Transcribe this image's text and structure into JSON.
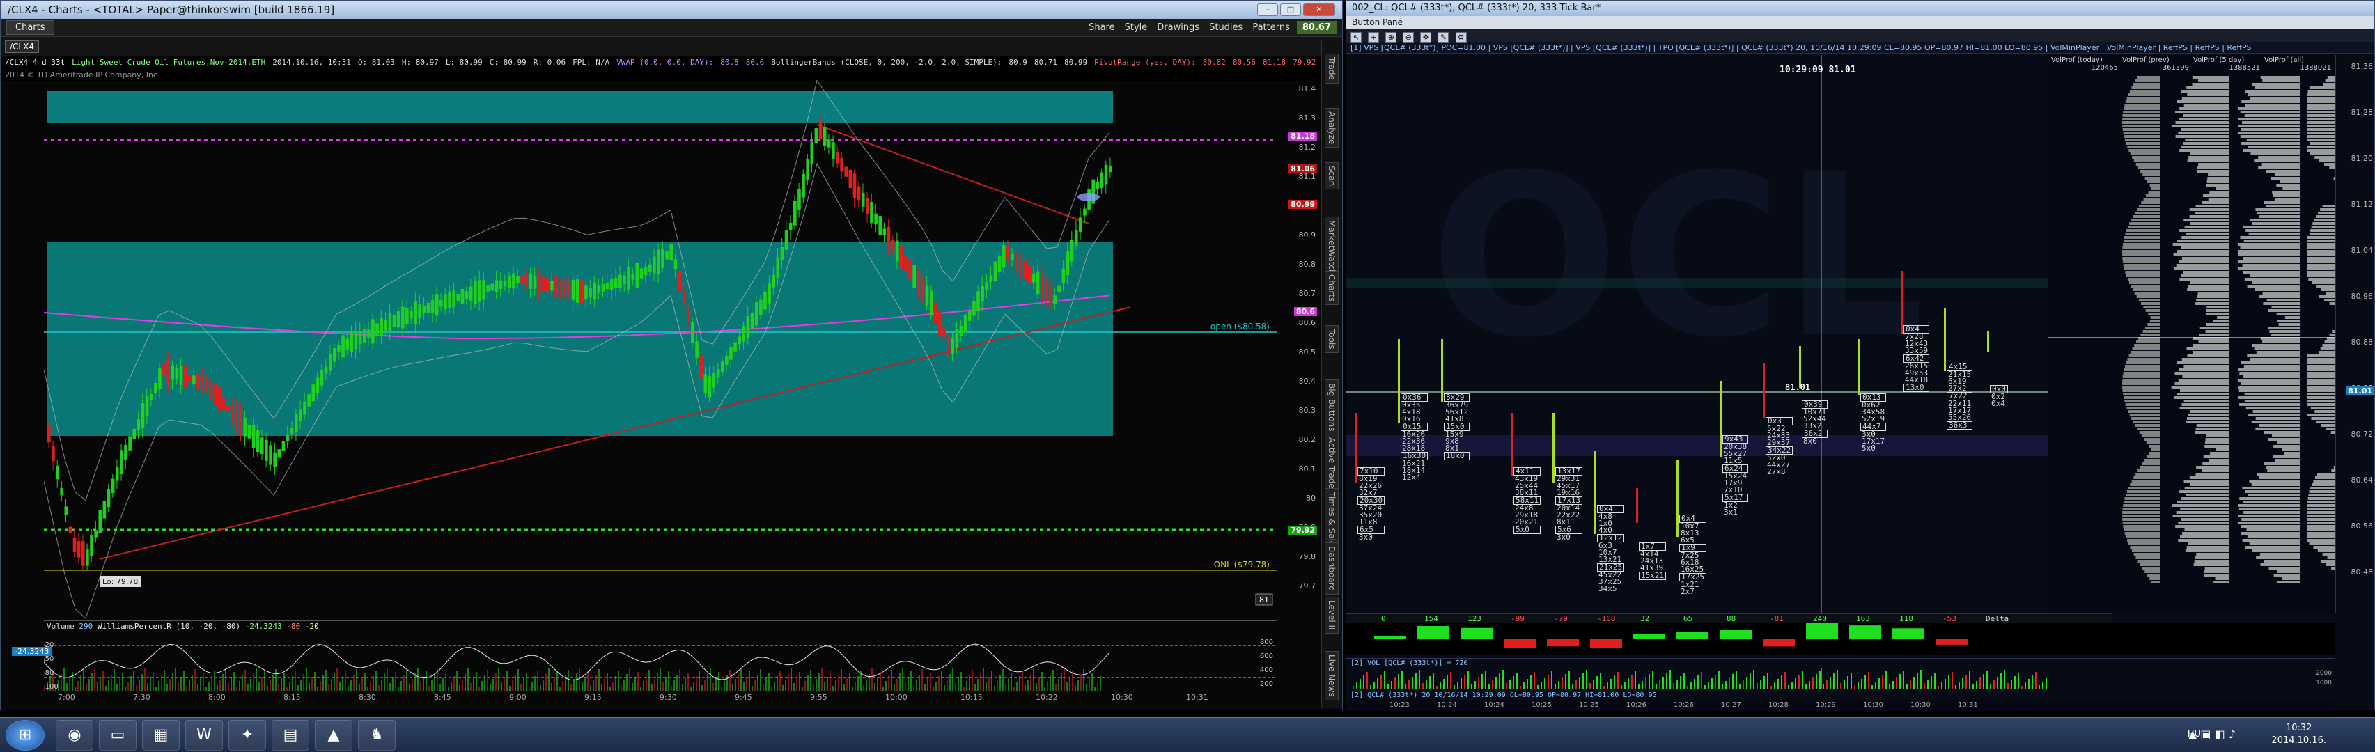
{
  "left_window": {
    "title": "/CLX4 - Charts - <TOTAL> Paper@thinkorswim [build 1866.19]",
    "tab": "Charts",
    "toolbar": {
      "symbol": "/CLX4",
      "share": "Share",
      "style": "Style",
      "drawings": "Drawings",
      "studies": "Studies",
      "patterns": "Patterns",
      "last_price": "80.67"
    },
    "study_row1": [
      "/CLX4 4 d 33t",
      "Light Sweet Crude Oil Futures,Nov-2014,ETH",
      "2014.10.16, 10:31",
      "O: 81.03",
      "H: 80.97",
      "L: 80.99",
      "C: 80.99",
      "R: 0.06",
      "FPL: N/A",
      "VWAP (0.0, 0.0, DAY):",
      "80.8",
      "80.6",
      "BollingerBands (CLOSE, 0, 200, -2.0, 2.0, SIMPLE):",
      "80.9",
      "80.71",
      "80.99",
      "PivotRange (yes, DAY):",
      "80.82",
      "80.56",
      "81.18",
      "79.92",
      "78.74"
    ],
    "study_row2": "2014 © TD Ameritrade IP Company, Inc.",
    "price_ticks": [
      "81.4",
      "81.3",
      "81.2",
      "81.1",
      "81",
      "80.9",
      "80.8",
      "80.7",
      "80.6",
      "80.5",
      "80.4",
      "80.3",
      "80.2",
      "80.1",
      "80",
      "79.9",
      "79.8",
      "79.7"
    ],
    "price_flags": [
      {
        "label": "81.18",
        "color": "#c83ad8"
      },
      {
        "label": "81.06",
        "color": "#b01818"
      },
      {
        "label": "80.99",
        "color": "#c81818"
      },
      {
        "label": "80.6",
        "color": "#c83ad8"
      },
      {
        "label": "79.92",
        "color": "#19a019"
      }
    ],
    "annotations": {
      "open_label": "open ($80.58)",
      "onl_label": "ONL ($79.78)",
      "lo_label": "Lo: 79.78",
      "page_num": "81"
    },
    "lower_study": {
      "label1": "Volume",
      "val1": "290",
      "label2": "WilliamsPercentR (10, -20, -80)",
      "val2": "-24.3243",
      "val3": "-80",
      "val4": "-20",
      "current": "-24.3243",
      "ticks": [
        "-20",
        "-50",
        "-80",
        "-100"
      ],
      "right_ticks": [
        "800",
        "600",
        "400",
        "200"
      ]
    },
    "time_labels": [
      "7:00",
      "7:30",
      "8:00",
      "8:15",
      "8:30",
      "8:45",
      "9:00",
      "9:15",
      "9:30",
      "9:45",
      "9:55",
      "10:00",
      "10:15",
      "10:22",
      "10:30",
      "10:31"
    ],
    "side_tabs": [
      "Trade",
      "Analyze",
      "Scan",
      "MarketWatch",
      "Charts",
      "Tools",
      "Big Buttons",
      "Active Trader",
      "Times & Sales",
      "Dashboard",
      "Level II",
      "Live News"
    ]
  },
  "right_window": {
    "title": "002_CL: QCL# (333t*), QCL# (333t*) 20, 333 Tick Bar*",
    "subtitle": "Button Pane",
    "study_line": "[1] VPS [QCL# (333t*)] POC=81.00 | VPS [QCL# (333t*)] | VPS [QCL# (333t*)] | TPO [QCL# (333t*)] | QCL# (333t*) 20, 10/16/14 10:29:09 CL=80.95 OP=80.97 HI=81.00 LO=80.95 | VolMinPlayer | VolMinPlayer | ReffPS | ReffPS | ReffPS",
    "crosshair_time": "10:29:09",
    "crosshair_price": "81.01",
    "vp_headers": [
      {
        "name": "VolProf (today)",
        "value": "120465"
      },
      {
        "name": "VolProf (prev)",
        "value": "361399"
      },
      {
        "name": "VolProf (5 day)",
        "value": "1388521"
      },
      {
        "name": "VolProf (all)",
        "value": "1388021"
      }
    ],
    "price_ticks": [
      "81.36",
      "81.28",
      "81.20",
      "81.12",
      "81.04",
      "80.96",
      "80.88",
      "80.80",
      "80.72",
      "80.64",
      "80.56",
      "80.48"
    ],
    "cursor_price": "81.01",
    "level_label": "81.01",
    "delta_row": [
      "0",
      "154",
      "123",
      "-99",
      "-79",
      "-108",
      "32",
      "65",
      "88",
      "-81",
      "240",
      "163",
      "118",
      "-53"
    ],
    "delta_label": "Delta",
    "vol_study": "[2] VOL [QCL# (333t*)] = 720",
    "vol_status": "[2] QCL# (333t*) 20 10/16/14 10:29:09 CL=80.95 OP=80.97 HI=81.00 LO=80.95",
    "time_labels": [
      "10:23",
      "10:24",
      "10:24",
      "10:25",
      "10:25",
      "10:26",
      "10:26",
      "10:27",
      "10:28",
      "10:29",
      "10:30",
      "10:30",
      "10:31"
    ],
    "vol_axis": [
      "2000",
      "1000"
    ],
    "footprint_bars": [
      {
        "rows": [
          "7x10",
          "8x19",
          "22x26",
          "32x7",
          "20x30",
          "37x24",
          "35x20",
          "11x8",
          "6x5",
          "3x0"
        ]
      },
      {
        "rows": [
          "0x36",
          "0x35",
          "4x18",
          "0x16",
          "0x15",
          "16x26",
          "22x36",
          "28x18",
          "16x30",
          "16x21",
          "18x14",
          "12x4"
        ]
      },
      {
        "rows": [
          "8x29",
          "36x79",
          "56x12",
          "41x8",
          "15x0",
          "15x9",
          "9x8",
          "8x1",
          "18x0"
        ]
      },
      {
        "rows": [
          "4x11",
          "43x19",
          "25x44",
          "38x11",
          "58x11",
          "24x8",
          "29x18",
          "20x21",
          "5x0"
        ]
      },
      {
        "rows": [
          "13x17",
          "29x31",
          "45x17",
          "19x16",
          "17x13",
          "20x14",
          "22x22",
          "8x11",
          "5x6",
          "3x0"
        ]
      },
      {
        "rows": [
          "0x4",
          "4x8",
          "1x0",
          "4x0",
          "12x12",
          "6x3",
          "10x7",
          "13x21",
          "21x25",
          "45x22",
          "37x25",
          "34x5"
        ]
      },
      {
        "rows": [
          "1x7",
          "4x14",
          "24x13",
          "41x39",
          "15x21"
        ]
      },
      {
        "rows": [
          "0x4",
          "10x7",
          "8x13",
          "6x5",
          "1x9",
          "7x25",
          "6x18",
          "16x25",
          "17x25",
          "1x21",
          "2x7"
        ]
      },
      {
        "rows": [
          "9x43",
          "20x38",
          "55x27",
          "11x5",
          "6x24",
          "15x24",
          "17x9",
          "7x10",
          "5x17",
          "1x2",
          "3x1"
        ]
      },
      {
        "rows": [
          "0x3",
          "5x22",
          "24x33",
          "29x37",
          "34x22",
          "52x0",
          "44x27",
          "27x8"
        ]
      },
      {
        "rows": [
          "0x39",
          "10x71",
          "52x44",
          "33x2",
          "36x2",
          "8x0"
        ]
      },
      {
        "rows": [
          "0x13",
          "0x62",
          "34x58",
          "52x19",
          "44x7",
          "3x0",
          "17x17",
          "5x0"
        ]
      },
      {
        "rows": [
          "0x4",
          "7x28",
          "12x43",
          "33x59",
          "6x42",
          "26x15",
          "49x53",
          "44x18",
          "13x0"
        ]
      },
      {
        "rows": [
          "4x15",
          "21x15",
          "6x19",
          "27x2",
          "7x22",
          "22x11",
          "17x17",
          "55x26",
          "36x3"
        ]
      },
      {
        "rows": [
          "0x0",
          "0x2",
          "0x4"
        ]
      }
    ]
  },
  "taskbar": {
    "lang": "HU",
    "time": "10:32",
    "date": "2014.10.16."
  }
}
